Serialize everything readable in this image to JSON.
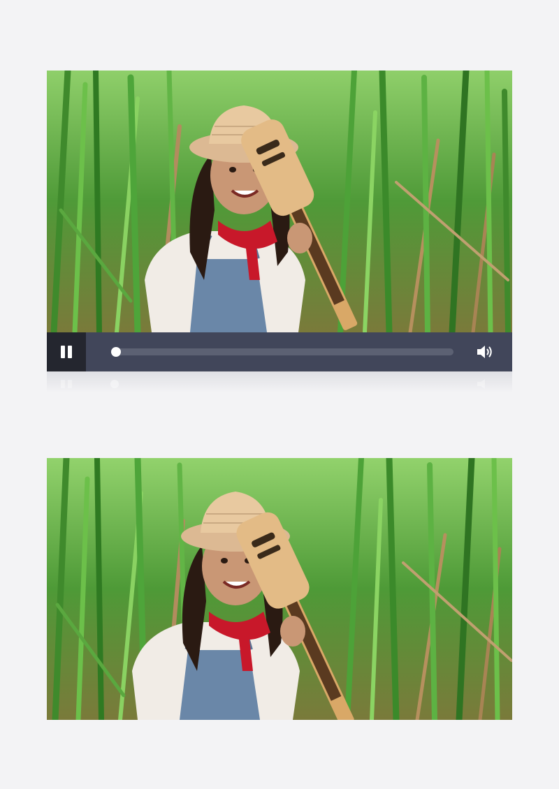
{
  "player": {
    "state": "playing",
    "progress": 0.0,
    "controls": {
      "play_pause_icon": "pause-icon",
      "volume_icon": "speaker-volume-icon"
    }
  },
  "scene": {
    "subject": "girl-with-ukulele-in-tall-grass",
    "colors": {
      "grass_light": "#6fbf4a",
      "grass_dark": "#2f6a25",
      "dry_grass": "#b08a5a",
      "hat": "#e8c9a0",
      "scarf": "#c8182a",
      "overalls": "#6a87a8",
      "shirt": "#f1ece6",
      "ukulele": "#e3bb86",
      "control_bar": "#41465a",
      "control_dark": "#24262f"
    }
  }
}
